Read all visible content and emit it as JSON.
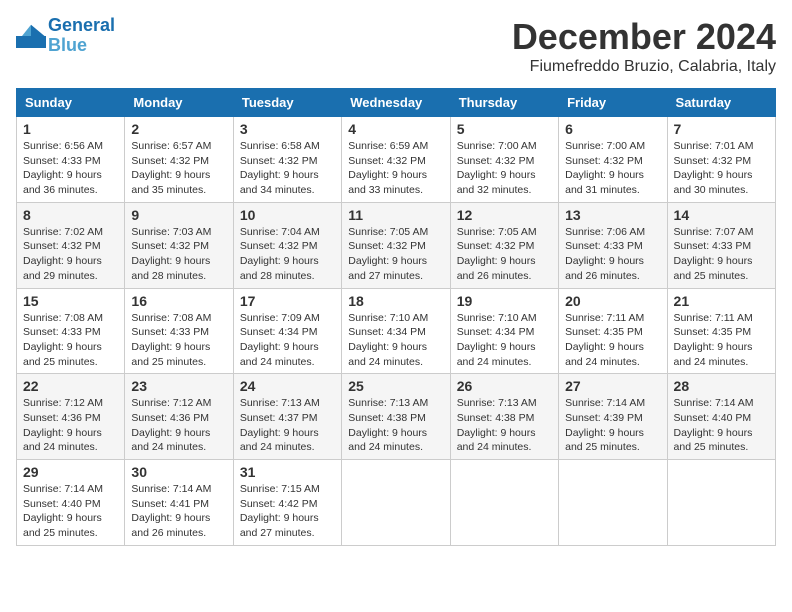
{
  "header": {
    "logo_line1": "General",
    "logo_line2": "Blue",
    "month": "December 2024",
    "location": "Fiumefreddo Bruzio, Calabria, Italy"
  },
  "weekdays": [
    "Sunday",
    "Monday",
    "Tuesday",
    "Wednesday",
    "Thursday",
    "Friday",
    "Saturday"
  ],
  "weeks": [
    [
      {
        "day": "1",
        "sunrise": "6:56 AM",
        "sunset": "4:33 PM",
        "daylight": "9 hours and 36 minutes."
      },
      {
        "day": "2",
        "sunrise": "6:57 AM",
        "sunset": "4:32 PM",
        "daylight": "9 hours and 35 minutes."
      },
      {
        "day": "3",
        "sunrise": "6:58 AM",
        "sunset": "4:32 PM",
        "daylight": "9 hours and 34 minutes."
      },
      {
        "day": "4",
        "sunrise": "6:59 AM",
        "sunset": "4:32 PM",
        "daylight": "9 hours and 33 minutes."
      },
      {
        "day": "5",
        "sunrise": "7:00 AM",
        "sunset": "4:32 PM",
        "daylight": "9 hours and 32 minutes."
      },
      {
        "day": "6",
        "sunrise": "7:00 AM",
        "sunset": "4:32 PM",
        "daylight": "9 hours and 31 minutes."
      },
      {
        "day": "7",
        "sunrise": "7:01 AM",
        "sunset": "4:32 PM",
        "daylight": "9 hours and 30 minutes."
      }
    ],
    [
      {
        "day": "8",
        "sunrise": "7:02 AM",
        "sunset": "4:32 PM",
        "daylight": "9 hours and 29 minutes."
      },
      {
        "day": "9",
        "sunrise": "7:03 AM",
        "sunset": "4:32 PM",
        "daylight": "9 hours and 28 minutes."
      },
      {
        "day": "10",
        "sunrise": "7:04 AM",
        "sunset": "4:32 PM",
        "daylight": "9 hours and 28 minutes."
      },
      {
        "day": "11",
        "sunrise": "7:05 AM",
        "sunset": "4:32 PM",
        "daylight": "9 hours and 27 minutes."
      },
      {
        "day": "12",
        "sunrise": "7:05 AM",
        "sunset": "4:32 PM",
        "daylight": "9 hours and 26 minutes."
      },
      {
        "day": "13",
        "sunrise": "7:06 AM",
        "sunset": "4:33 PM",
        "daylight": "9 hours and 26 minutes."
      },
      {
        "day": "14",
        "sunrise": "7:07 AM",
        "sunset": "4:33 PM",
        "daylight": "9 hours and 25 minutes."
      }
    ],
    [
      {
        "day": "15",
        "sunrise": "7:08 AM",
        "sunset": "4:33 PM",
        "daylight": "9 hours and 25 minutes."
      },
      {
        "day": "16",
        "sunrise": "7:08 AM",
        "sunset": "4:33 PM",
        "daylight": "9 hours and 25 minutes."
      },
      {
        "day": "17",
        "sunrise": "7:09 AM",
        "sunset": "4:34 PM",
        "daylight": "9 hours and 24 minutes."
      },
      {
        "day": "18",
        "sunrise": "7:10 AM",
        "sunset": "4:34 PM",
        "daylight": "9 hours and 24 minutes."
      },
      {
        "day": "19",
        "sunrise": "7:10 AM",
        "sunset": "4:34 PM",
        "daylight": "9 hours and 24 minutes."
      },
      {
        "day": "20",
        "sunrise": "7:11 AM",
        "sunset": "4:35 PM",
        "daylight": "9 hours and 24 minutes."
      },
      {
        "day": "21",
        "sunrise": "7:11 AM",
        "sunset": "4:35 PM",
        "daylight": "9 hours and 24 minutes."
      }
    ],
    [
      {
        "day": "22",
        "sunrise": "7:12 AM",
        "sunset": "4:36 PM",
        "daylight": "9 hours and 24 minutes."
      },
      {
        "day": "23",
        "sunrise": "7:12 AM",
        "sunset": "4:36 PM",
        "daylight": "9 hours and 24 minutes."
      },
      {
        "day": "24",
        "sunrise": "7:13 AM",
        "sunset": "4:37 PM",
        "daylight": "9 hours and 24 minutes."
      },
      {
        "day": "25",
        "sunrise": "7:13 AM",
        "sunset": "4:38 PM",
        "daylight": "9 hours and 24 minutes."
      },
      {
        "day": "26",
        "sunrise": "7:13 AM",
        "sunset": "4:38 PM",
        "daylight": "9 hours and 24 minutes."
      },
      {
        "day": "27",
        "sunrise": "7:14 AM",
        "sunset": "4:39 PM",
        "daylight": "9 hours and 25 minutes."
      },
      {
        "day": "28",
        "sunrise": "7:14 AM",
        "sunset": "4:40 PM",
        "daylight": "9 hours and 25 minutes."
      }
    ],
    [
      {
        "day": "29",
        "sunrise": "7:14 AM",
        "sunset": "4:40 PM",
        "daylight": "9 hours and 25 minutes."
      },
      {
        "day": "30",
        "sunrise": "7:14 AM",
        "sunset": "4:41 PM",
        "daylight": "9 hours and 26 minutes."
      },
      {
        "day": "31",
        "sunrise": "7:15 AM",
        "sunset": "4:42 PM",
        "daylight": "9 hours and 27 minutes."
      },
      null,
      null,
      null,
      null
    ]
  ]
}
